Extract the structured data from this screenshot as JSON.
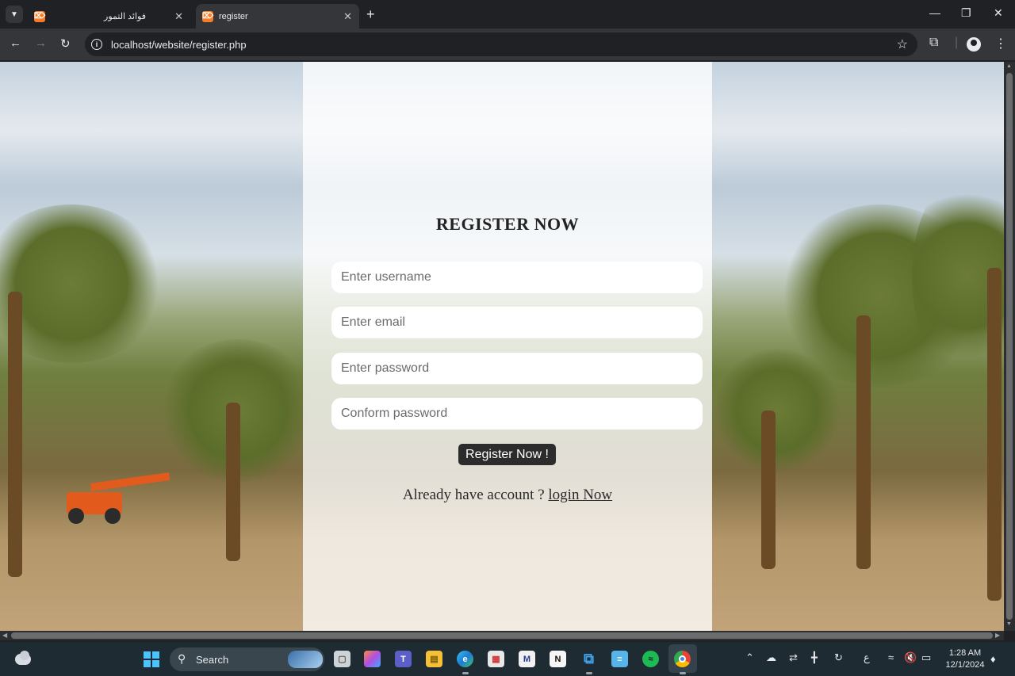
{
  "browser": {
    "tabs": [
      {
        "title": "فوائد التمور",
        "favicon": "xampp-icon",
        "active": false
      },
      {
        "title": "register",
        "favicon": "xampp-icon",
        "active": true
      }
    ],
    "url": "localhost/website/register.php"
  },
  "form": {
    "title": "REGISTER NOW",
    "username_placeholder": "Enter username",
    "email_placeholder": "Enter email",
    "password_placeholder": "Enter password",
    "confirm_placeholder": "Conform password",
    "submit_label": "Register Now !",
    "login_prompt": "Already have account ?",
    "login_link": "login Now"
  },
  "taskbar": {
    "search_label": "Search",
    "apps": [
      "file-explorer-app",
      "copilot",
      "teams",
      "files",
      "edge",
      "store",
      "mail",
      "notion",
      "vscode",
      "notepad",
      "spotify",
      "chrome"
    ],
    "language": "ع",
    "time": "1:28 AM",
    "date": "12/1/2024"
  },
  "colors": {
    "panel_overlay": "#ffffffc7",
    "button_bg": "#2c2c2c",
    "taskbar_bg": "#1f2b33",
    "browser_dark": "#202124"
  }
}
